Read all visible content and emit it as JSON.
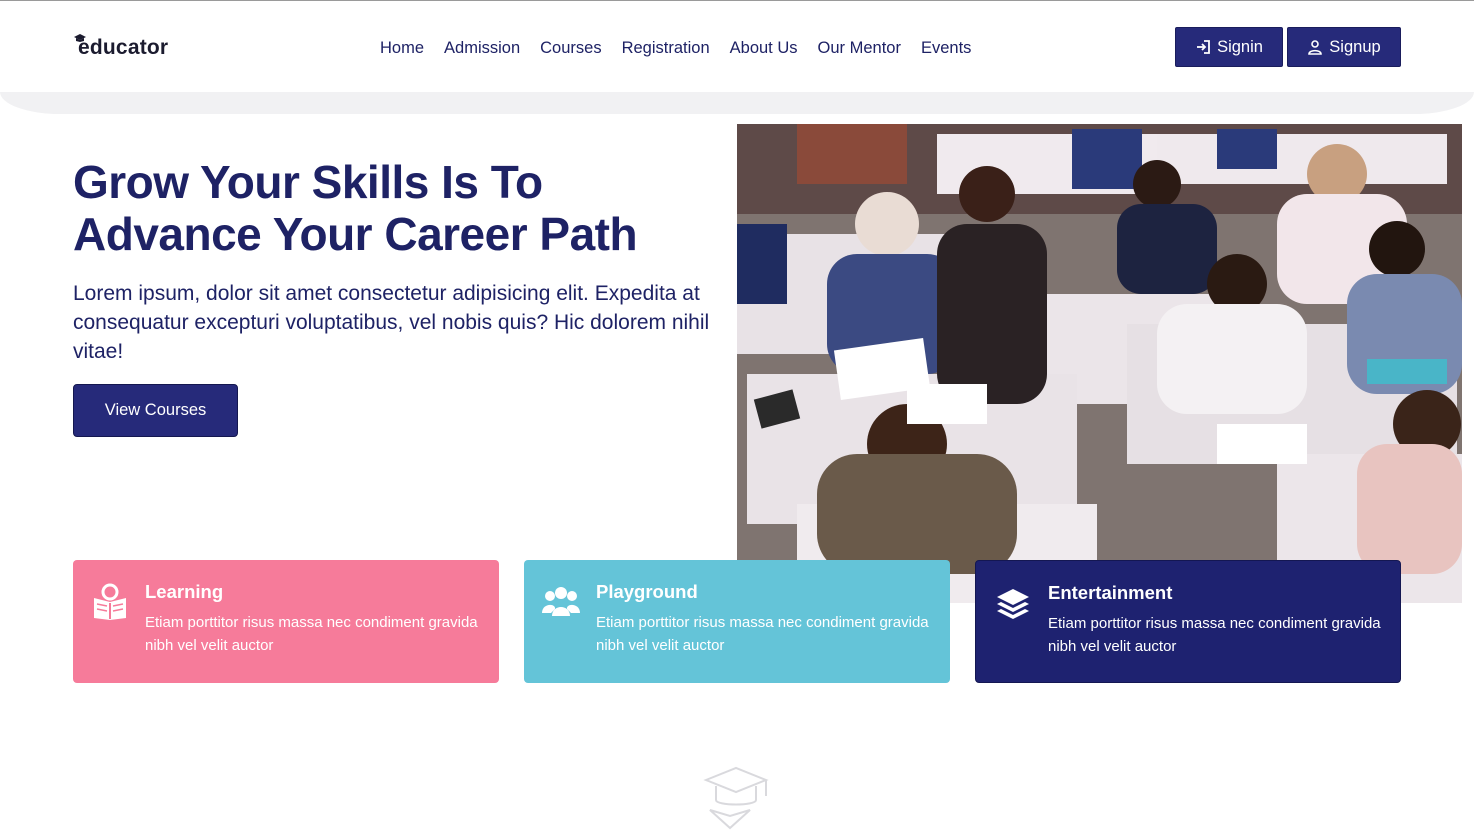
{
  "header": {
    "logo_text": "educator",
    "nav": [
      "Home",
      "Admission",
      "Courses",
      "Registration",
      "About Us",
      "Our Mentor",
      "Events"
    ],
    "signin_label": "Signin",
    "signup_label": "Signup"
  },
  "hero": {
    "title": "Grow Your Skills Is To Advance Your Career Path",
    "description": "Lorem ipsum, dolor sit amet consectetur adipisicing elit. Expedita at consequatur excepturi voluptatibus, vel nobis quis? Hic dolorem nihil vitae!",
    "cta_label": "View Courses"
  },
  "features": [
    {
      "title": "Learning",
      "text": "Etiam porttitor risus massa nec condiment gravida nibh vel velit auctor",
      "icon": "reading-icon",
      "color": "#f67b9a"
    },
    {
      "title": "Playground",
      "text": "Etiam porttitor risus massa nec condiment gravida nibh vel velit auctor",
      "icon": "users-icon",
      "color": "#64c4d8"
    },
    {
      "title": "Entertainment",
      "text": "Etiam porttitor risus massa nec condiment gravida nibh vel velit auctor",
      "icon": "layers-icon",
      "color": "#1e2270"
    }
  ],
  "colors": {
    "primary": "#262a7a",
    "heading": "#1e2265"
  }
}
